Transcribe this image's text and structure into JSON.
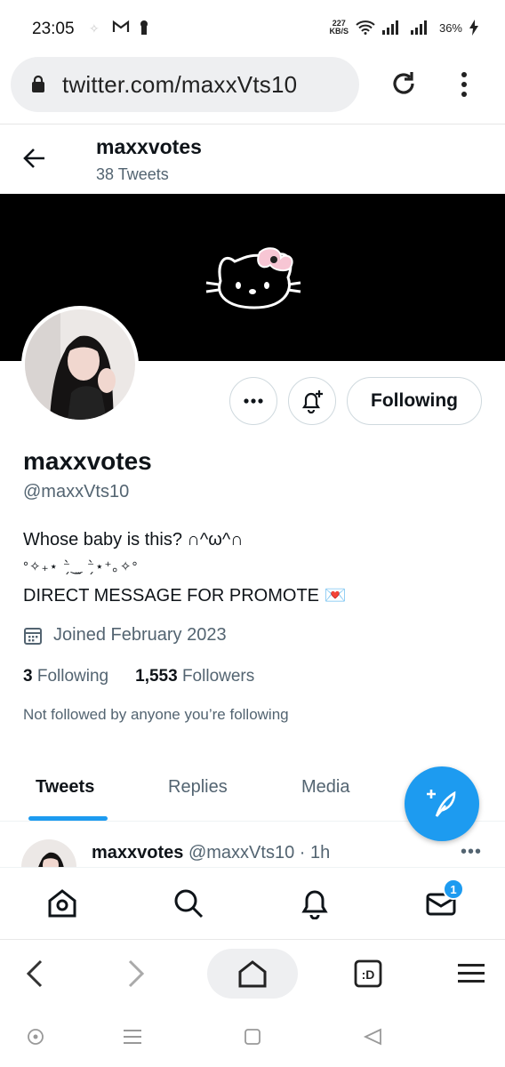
{
  "status_bar": {
    "time": "23:05",
    "speed_top": "227",
    "speed_bottom": "KB/S",
    "battery": "36%"
  },
  "browser": {
    "url": "twitter.com/maxxVts10"
  },
  "header": {
    "name": "maxxvotes",
    "tweet_count": "38 Tweets"
  },
  "profile": {
    "name": "maxxvotes",
    "handle": "@maxxVts10",
    "bio_line1": "Whose baby is this? ∩^ω^∩",
    "bio_line2": "°✧₊⋆  ⁻̗̀‿̫  ⁻̗̀⋆⁺｡✧°",
    "bio_line3": "DIRECT MESSAGE FOR PROMOTE 💌",
    "joined": "Joined February 2023",
    "following_count": "3",
    "following_label": "Following",
    "followers_count": "1,553",
    "followers_label": "Followers",
    "not_followed": "Not followed by anyone you’re following",
    "follow_button_label": "Following"
  },
  "tabs": [
    "Tweets",
    "Replies",
    "Media"
  ],
  "tweet": {
    "name": "maxxvotes",
    "meta": "@maxxVts10 · 1h"
  },
  "app_nav": {
    "messages_badge": "1"
  },
  "colors": {
    "accent": "#1d9bf0",
    "secondary_text": "#536471"
  }
}
